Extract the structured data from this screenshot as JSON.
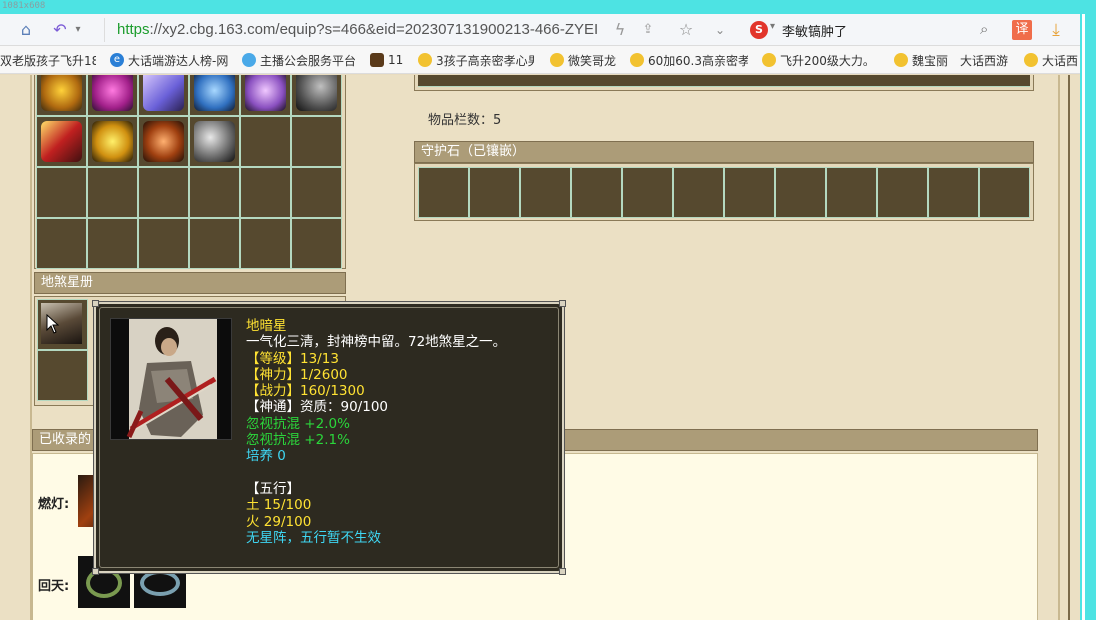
{
  "window": {
    "dimension_tag": "1081x608"
  },
  "browser": {
    "url_scheme": "https",
    "url_rest": "://xy2.cbg.163.com/equip?s=466&eid=202307131900213-466-ZYEI",
    "search_text": "李敏镐肿了",
    "translate_label": "译",
    "icons": [
      "home-icon",
      "back-icon",
      "lightning-icon",
      "share-icon",
      "star-icon",
      "chevron-down-icon",
      "search-icon",
      "download-icon"
    ]
  },
  "bookmarks": [
    {
      "label": "双老版孩子飞升18"
    },
    {
      "label": "大话端游达人榜-网"
    },
    {
      "label": "主播公会服务平台"
    },
    {
      "label": "11"
    },
    {
      "label": "3孩子高亲密孝心男"
    },
    {
      "label": "微笑哥龙"
    },
    {
      "label": "60加60.3高亲密孝"
    },
    {
      "label": "飞升200级大力。"
    },
    {
      "label": "魏宝丽"
    },
    {
      "label": "大话西游"
    },
    {
      "label": "大话西"
    }
  ],
  "inventory": {
    "items_count_label": "物品栏数：5",
    "guard_stone_title": "守护石（已镶嵌）"
  },
  "star_book": {
    "title": "地煞星册"
  },
  "collection": {
    "title": "已收录的",
    "rows": [
      {
        "label": "燃灯:"
      },
      {
        "label": "回天:"
      }
    ]
  },
  "tooltip": {
    "name": "地暗星",
    "description": "一气化三清，封神榜中留。72地煞星之一。",
    "level": "【等级】13/13",
    "divine_power": "【神力】1/2600",
    "combat_power": "【战力】160/1300",
    "aptitude": "【神通】资质：90/100",
    "ignore_resist_1": "忽视抗混 +2.0%",
    "ignore_resist_2": "忽视抗混 +2.1%",
    "cultivation": "培养 0",
    "wuxing_title": "【五行】",
    "earth": "土 15/100",
    "fire": "火 29/100",
    "no_array": "无星阵，五行暂不生效"
  }
}
